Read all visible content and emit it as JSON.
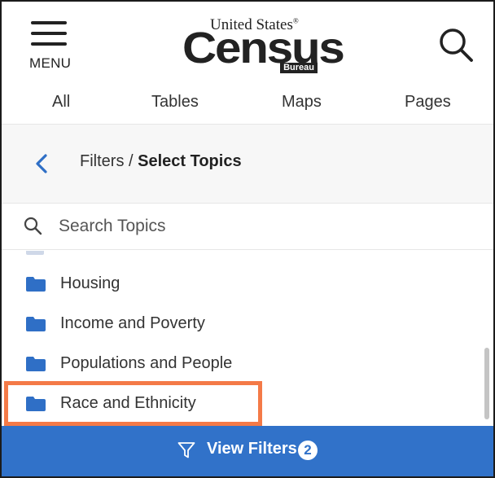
{
  "header": {
    "menu_label": "MENU",
    "logo_top": "United States",
    "logo_registered": "®",
    "logo_main": "Census",
    "logo_bureau": "Bureau"
  },
  "tabs": [
    {
      "label": "All"
    },
    {
      "label": "Tables"
    },
    {
      "label": "Maps"
    },
    {
      "label": "Pages"
    }
  ],
  "filter_bar": {
    "crumb_prefix": "Filters / ",
    "crumb_current": "Select Topics"
  },
  "search": {
    "placeholder": "Search Topics",
    "value": ""
  },
  "topics": [
    {
      "label": "Housing"
    },
    {
      "label": "Income and Poverty"
    },
    {
      "label": "Populations and People"
    },
    {
      "label": "Race and Ethnicity",
      "highlighted": true
    }
  ],
  "view_filters": {
    "label": "View Filters",
    "count": "2"
  },
  "colors": {
    "primary": "#3172c9",
    "folder": "#2f6fc6",
    "highlight_border": "#f47a47",
    "back_arrow": "#2f6fc6"
  },
  "icons": [
    "menu-icon",
    "search-icon",
    "chevron-left-icon",
    "folder-icon",
    "filter-funnel-icon"
  ]
}
